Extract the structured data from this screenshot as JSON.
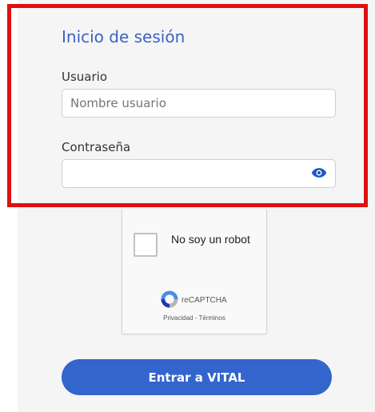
{
  "login": {
    "title": "Inicio de sesión",
    "username_label": "Usuario",
    "username_placeholder": "Nombre usuario",
    "username_value": "",
    "password_label": "Contraseña",
    "password_value": "",
    "show_password_icon": "eye-icon",
    "submit_label": "Entrar a VITAL"
  },
  "captcha": {
    "checkbox_label": "No soy un robot",
    "brand": "reCAPTCHA",
    "privacy_link": "Privacidad",
    "separator": " - ",
    "terms_link": "Términos"
  },
  "colors": {
    "accent": "#3365cc",
    "title": "#3b62c4",
    "highlight_border": "#e01010",
    "panel_background": "#f5f5f5"
  }
}
